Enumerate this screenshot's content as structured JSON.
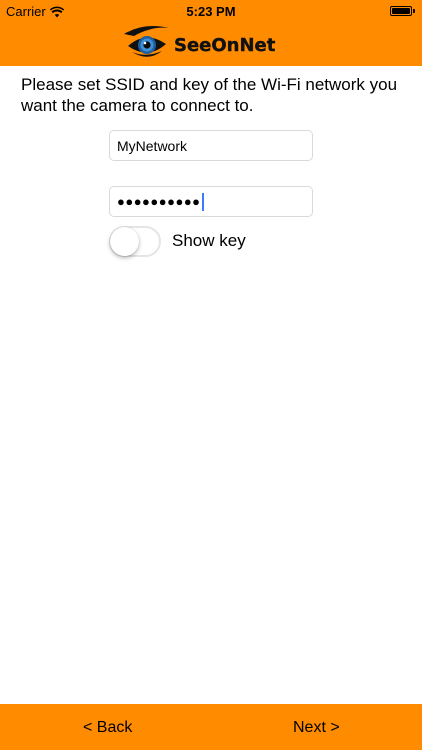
{
  "status_bar": {
    "carrier": "Carrier",
    "time": "5:23 PM",
    "battery_level": 1.0
  },
  "header": {
    "logo_text": "SeeOnNet",
    "background_color": "#ff8c00"
  },
  "content": {
    "instructions": "Please set SSID and key of the Wi-Fi network you want the camera to connect to.",
    "ssid_value": "MyNetwork",
    "key_value": "●●●●●●●●●●",
    "show_key_label": "Show key",
    "show_key_on": false
  },
  "footer": {
    "back_label": "< Back",
    "next_label": "Next >"
  },
  "icons": {
    "wifi": "wifi-icon",
    "battery": "battery-icon",
    "logo": "eye-logo-icon"
  }
}
